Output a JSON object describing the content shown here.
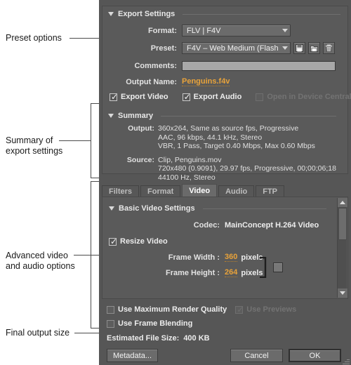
{
  "annotations": [
    {
      "id": "preset-options",
      "text": "Preset options"
    },
    {
      "id": "summary-of-export-settings",
      "line1": "Summary of",
      "line2": "export settings"
    },
    {
      "id": "advanced-video-and-audio-options",
      "line1": "Advanced video",
      "line2": "and audio options"
    },
    {
      "id": "final-output-size",
      "text": "Final output size"
    }
  ],
  "export_settings": {
    "title": "Export Settings",
    "format": {
      "label": "Format:",
      "value": "FLV | F4V"
    },
    "preset": {
      "label": "Preset:",
      "value": "F4V – Web Medium (Flash ..."
    },
    "preset_buttons": [
      {
        "name": "save-preset-icon",
        "title": "Save Preset"
      },
      {
        "name": "import-preset-icon",
        "title": "Import Preset"
      },
      {
        "name": "delete-preset-icon",
        "title": "Delete Preset"
      }
    ],
    "comments": {
      "label": "Comments:",
      "value": "",
      "placeholder": ""
    },
    "output_name": {
      "label": "Output Name:",
      "value": "Penguins.f4v"
    },
    "checkboxes": [
      {
        "name": "export-video",
        "label": "Export Video",
        "checked": true,
        "disabled": false
      },
      {
        "name": "export-audio",
        "label": "Export Audio",
        "checked": true,
        "disabled": false
      },
      {
        "name": "open-in-device-central",
        "label": "Open in Device Central",
        "checked": false,
        "disabled": true
      }
    ]
  },
  "summary": {
    "title": "Summary",
    "output_label": "Output:",
    "output_lines": [
      "360x264, Same as source fps, Progressive",
      "AAC, 96 kbps, 44.1 kHz, Stereo",
      "VBR, 1 Pass, Target 0.40 Mbps, Max 0.60 Mbps"
    ],
    "source_label": "Source:",
    "source_lines": [
      "Clip, Penguins.mov",
      "720x480 (0.9091), 29.97 fps, Progressive, 00;00;06;18",
      "44100 Hz, Stereo"
    ]
  },
  "tabs": [
    {
      "id": "filters",
      "label": "Filters",
      "active": false
    },
    {
      "id": "format",
      "label": "Format",
      "active": false
    },
    {
      "id": "video",
      "label": "Video",
      "active": true
    },
    {
      "id": "audio",
      "label": "Audio",
      "active": false
    },
    {
      "id": "ftp",
      "label": "FTP",
      "active": false
    }
  ],
  "video_settings": {
    "title": "Basic Video Settings",
    "codec": {
      "label": "Codec:",
      "value": "MainConcept H.264 Video"
    },
    "resize_video": {
      "label": "Resize Video",
      "checked": true
    },
    "frame_width": {
      "label": "Frame Width :",
      "value": "360",
      "unit": "pixels"
    },
    "frame_height": {
      "label": "Frame Height :",
      "value": "264",
      "unit": "pixels"
    },
    "constrain": {
      "name": "constrain-proportions-checkbox",
      "checked": false
    }
  },
  "bottom": {
    "max_render_quality": {
      "label": "Use Maximum Render Quality",
      "checked": false,
      "disabled": false
    },
    "use_previews": {
      "label": "Use Previews",
      "checked": true,
      "disabled": true
    },
    "frame_blending": {
      "label": "Use Frame Blending",
      "checked": false,
      "disabled": false
    },
    "estimated_label": "Estimated File Size:",
    "estimated_value": "400 KB",
    "metadata_button": "Metadata...",
    "cancel_button": "Cancel",
    "ok_button": "OK"
  },
  "colors": {
    "window_bg": "#565656",
    "panel_bg": "#5a5a5a",
    "accent_link": "#e9a33a",
    "text": "#ececec",
    "disabled_text": "#737373"
  }
}
